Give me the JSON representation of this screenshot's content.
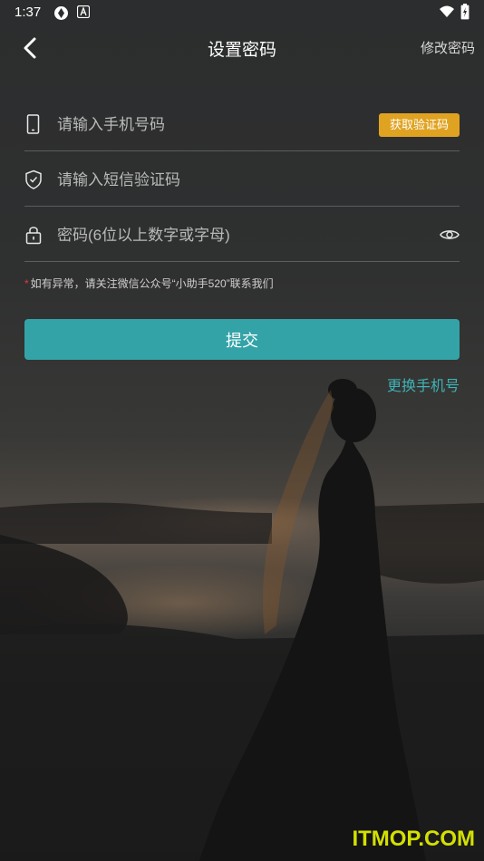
{
  "status_bar": {
    "time": "1:37"
  },
  "header": {
    "title": "设置密码",
    "right_link": "修改密码"
  },
  "form": {
    "phone": {
      "placeholder": "请输入手机号码",
      "icon": "phone-icon",
      "action_label": "获取验证码"
    },
    "sms_code": {
      "placeholder": "请输入短信验证码",
      "icon": "shield-check-icon"
    },
    "password": {
      "placeholder": "密码(6位以上数字或字母)",
      "icon": "lock-icon",
      "toggle_icon": "eye-icon"
    }
  },
  "notice": {
    "star": "*",
    "text": "如有异常，请关注微信公众号“小助手520”联系我们"
  },
  "submit_label": "提交",
  "change_phone_label": "更换手机号",
  "watermark": "ITMOP.COM",
  "colors": {
    "accent": "#33a3a8",
    "code_button": "#e0a321",
    "link": "#3fb3b6",
    "star": "#e23b3b",
    "watermark": "#d3e000"
  }
}
